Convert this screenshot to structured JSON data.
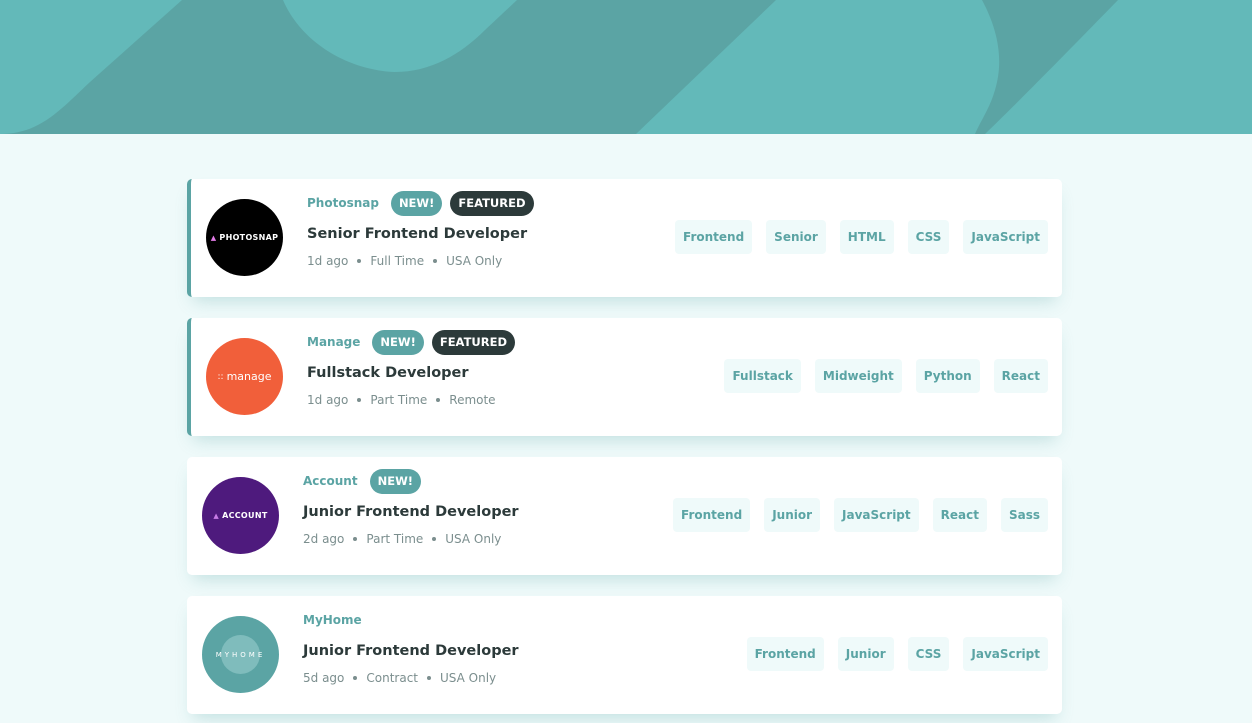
{
  "colors": {
    "accent": "#5ba4a4",
    "dark": "#2c3a3a",
    "background": "#effafa",
    "tag_background": "#effafa"
  },
  "jobs": [
    {
      "company": "Photosnap",
      "logo_text": "PHOTOSNAP",
      "logo_mark": "▲",
      "logo_color": "#000000",
      "new_label": "NEW!",
      "featured_label": "FEATURED",
      "position": "Senior Frontend Developer",
      "posted": "1d ago",
      "contract": "Full Time",
      "location": "USA Only",
      "tags": [
        "Frontend",
        "Senior",
        "HTML",
        "CSS",
        "JavaScript"
      ]
    },
    {
      "company": "Manage",
      "logo_text": "manage",
      "logo_mark": "::",
      "logo_color": "#f15f3a",
      "new_label": "NEW!",
      "featured_label": "FEATURED",
      "position": "Fullstack Developer",
      "posted": "1d ago",
      "contract": "Part Time",
      "location": "Remote",
      "tags": [
        "Fullstack",
        "Midweight",
        "Python",
        "React"
      ]
    },
    {
      "company": "Account",
      "logo_text": "ACCOUNT",
      "logo_mark": "▲",
      "logo_color": "#4e1a7d",
      "new_label": "NEW!",
      "position": "Junior Frontend Developer",
      "posted": "2d ago",
      "contract": "Part Time",
      "location": "USA Only",
      "tags": [
        "Frontend",
        "Junior",
        "JavaScript",
        "React",
        "Sass"
      ]
    },
    {
      "company": "MyHome",
      "logo_text": "MYHOME",
      "logo_color": "#5ba4a4",
      "position": "Junior Frontend Developer",
      "posted": "5d ago",
      "contract": "Contract",
      "location": "USA Only",
      "tags": [
        "Frontend",
        "Junior",
        "CSS",
        "JavaScript"
      ]
    }
  ]
}
